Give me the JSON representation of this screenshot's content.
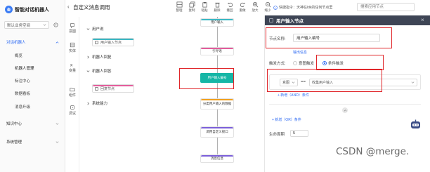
{
  "app": {
    "logo_text": "智能对话机器人"
  },
  "tenant": {
    "selected": "默认业务空间"
  },
  "nav": {
    "groups": [
      {
        "label": "对话机器人",
        "active": true
      },
      {
        "label": "知识中心",
        "active": false
      },
      {
        "label": "系统管理",
        "active": false
      }
    ],
    "subitems": [
      "概览",
      "机器人管理",
      "标注中心",
      "数据看板",
      "消息升级"
    ]
  },
  "header": {
    "back_label": "‹",
    "page_title": "自定义消息调用",
    "toolbar": [
      "整理",
      "复制",
      "粘贴",
      "删除",
      "撤回",
      "重做",
      "放大",
      "缩小"
    ],
    "shortcut_tip": "快捷指令：天神在ldk的任何节点里",
    "search_placeholder": "搜索应用节点"
  },
  "component_rail": [
    "意图",
    "实体",
    "变量",
    "组件",
    "调试"
  ],
  "component_panel": {
    "categories": [
      "用户说",
      "机器人回复",
      "机器人回答",
      "系统能力"
    ],
    "blocks": [
      "用户输入节点",
      "回复节点"
    ]
  },
  "flow": {
    "nodes": [
      "用户输入",
      "引导语",
      "用户输入编号",
      "分类用户输入的数据",
      "调用自定义接口",
      "消息信息"
    ]
  },
  "properties": {
    "title": "用户输入节点",
    "close_label": "×",
    "name_label": "节点名称:",
    "name_value": "用户输入编号",
    "hint_link": "输出信息",
    "trigger_label": "触发方式:",
    "trigger_options": [
      "意图触发",
      "条件触发"
    ],
    "trigger_selected": "条件触发",
    "condition": {
      "left": "意图",
      "operator": "==",
      "right": "收集用户输入"
    },
    "add_and_link": "+ 新增（AND）条件",
    "add_or_link": "+ 新增（OR）条件",
    "lifetime_label": "生命周期",
    "lifetime_value": "5"
  },
  "watermark": "CSDN @merge.",
  "colors": {
    "accent": "#2f6bf3",
    "selected_node": "#16b6a6",
    "highlight_red": "#e0262a",
    "panel_header": "#3e4555"
  }
}
